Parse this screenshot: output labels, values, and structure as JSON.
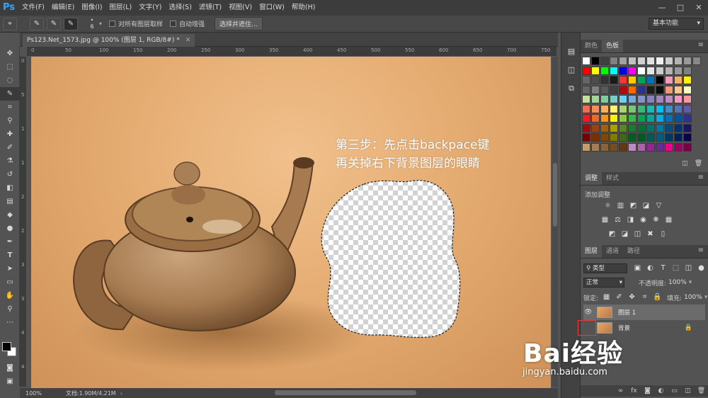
{
  "app": {
    "logo": "Ps",
    "menu": [
      "文件(F)",
      "编辑(E)",
      "图像(I)",
      "图层(L)",
      "文字(Y)",
      "选择(S)",
      "滤镜(T)",
      "视图(V)",
      "窗口(W)",
      "帮助(H)"
    ],
    "window_controls": [
      "—",
      "□",
      "✕"
    ]
  },
  "options": {
    "brush_size": "6",
    "sample_all_layers": "对所有图层取样",
    "auto_enhance": "自动增强",
    "select_mask": "选择并遮住...",
    "workspace": "基本功能"
  },
  "document": {
    "tab_title": "Ps123.Net_1573.jpg @ 100% (图层 1, RGB/8#) *",
    "annotation_line1": "第三步：先点击backpace键",
    "annotation_line2": "再关掉右下背景图层的眼睛",
    "ruler_top": [
      "0",
      "50",
      "100",
      "150",
      "200",
      "250",
      "300",
      "350",
      "400",
      "450",
      "500",
      "550",
      "600",
      "650",
      "700",
      "750"
    ],
    "ruler_left": [
      "0",
      "5",
      "1",
      "1",
      "2",
      "2",
      "3",
      "3",
      "4",
      "4"
    ]
  },
  "status": {
    "zoom": "100%",
    "doc_size": "文档:1.90M/4.21M"
  },
  "panels": {
    "color_tab": "颜色",
    "swatches_tab": "色板",
    "adjustments_tab": "调整",
    "styles_tab": "样式",
    "add_adjustment": "添加调整",
    "layers_tab": "图层",
    "channels_tab": "通道",
    "paths_tab": "路径",
    "filter_kind": "类型",
    "blend_mode": "正常",
    "opacity_label": "不透明度:",
    "opacity_value": "100%",
    "lock_label": "锁定:",
    "fill_label": "填充:",
    "fill_value": "100%",
    "layers": [
      {
        "name": "图层 1",
        "visible": true,
        "selected": true
      },
      {
        "name": "背景",
        "visible": false,
        "locked": true
      }
    ]
  },
  "watermark": {
    "main": "Bai经验",
    "sub": "jingyan.baidu.com"
  }
}
